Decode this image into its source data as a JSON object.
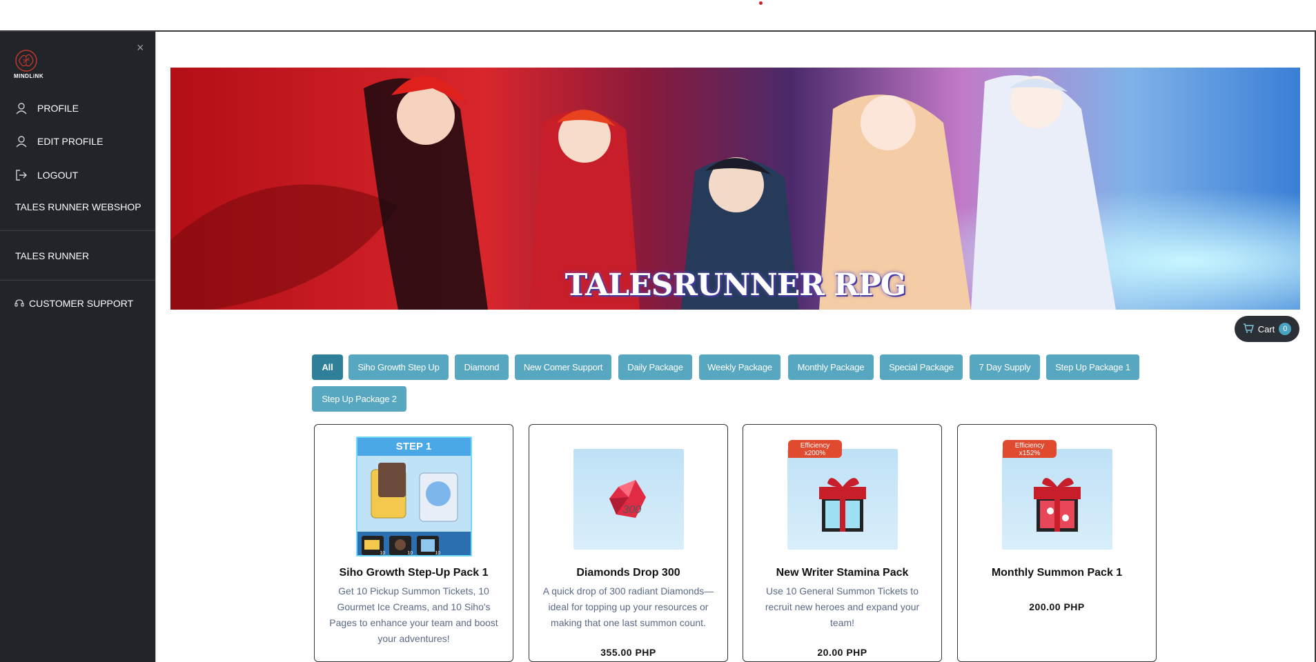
{
  "sidebar": {
    "logo_text": "MINDLiNK",
    "close_glyph": "×",
    "items": [
      {
        "label": "PROFILE",
        "icon": "user-icon"
      },
      {
        "label": "EDIT PROFILE",
        "icon": "user-icon"
      },
      {
        "label": "LOGOUT",
        "icon": "logout-icon"
      }
    ],
    "webshop_label": "TALES RUNNER WEBSHOP",
    "game_label": "TALES RUNNER",
    "support_label": "CUSTOMER SUPPORT",
    "support_icon": "headset-icon"
  },
  "banner": {
    "title": "TALESRUNNER RPG"
  },
  "cart": {
    "label": "Cart",
    "count": "0",
    "icon": "cart-icon"
  },
  "filters": [
    {
      "label": "All",
      "active": true
    },
    {
      "label": "Siho Growth Step Up"
    },
    {
      "label": "Diamond"
    },
    {
      "label": "New Comer Support"
    },
    {
      "label": "Daily Package"
    },
    {
      "label": "Weekly Package"
    },
    {
      "label": "Monthly Package"
    },
    {
      "label": "Special Package"
    },
    {
      "label": "7 Day Supply"
    },
    {
      "label": "Step Up Package 1"
    },
    {
      "label": "Step Up Package 2"
    }
  ],
  "products": [
    {
      "name": "Siho Growth Step-Up Pack 1",
      "description": "Get 10 Pickup Summon Tickets, 10 Gourmet Ice Creams, and 10 Siho's Pages to enhance your team and boost your adventures!",
      "price": "",
      "image_text": "STEP 1",
      "counts": [
        "10",
        "10",
        "10"
      ]
    },
    {
      "name": "Diamonds Drop 300",
      "description": "A quick drop of 300 radiant Diamonds—ideal for topping up your resources or making that one last summon count.",
      "price": "355.00 PHP",
      "image_text": "300"
    },
    {
      "name": "New Writer Stamina Pack",
      "description": "Use 10 General Summon Tickets to recruit new heroes and expand your team!",
      "price": "20.00 PHP",
      "badge": "Efficiency x200%"
    },
    {
      "name": "Monthly Summon Pack 1",
      "description": "",
      "price": "200.00 PHP",
      "badge": "Efficiency x152%"
    }
  ],
  "colors": {
    "sidebar_bg": "#212429",
    "filter_button": "#56a7bf",
    "filter_active": "#2f7f99",
    "badge_red": "#e04a2f"
  }
}
